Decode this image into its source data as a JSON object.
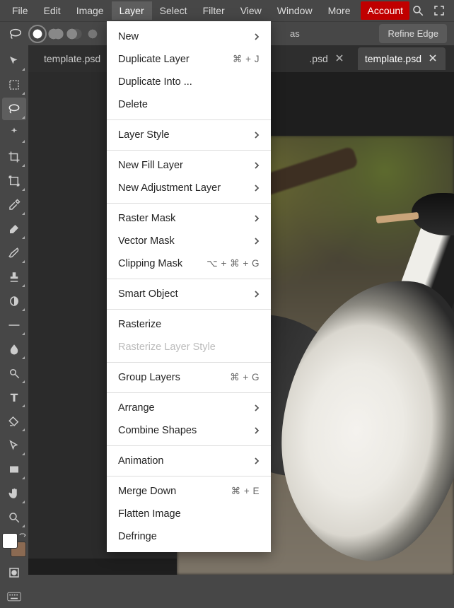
{
  "menubar": {
    "items": [
      "File",
      "Edit",
      "Image",
      "Layer",
      "Select",
      "Filter",
      "View",
      "Window",
      "More"
    ],
    "active_index": 3,
    "account": "Account"
  },
  "toolbar": {
    "as_label_fragment": "as",
    "refine_edge": "Refine Edge"
  },
  "tabs": [
    {
      "label": "template.psd",
      "closable": false
    },
    {
      "label": ".psd",
      "closable": true
    },
    {
      "label": "template.psd",
      "closable": true,
      "active": true
    }
  ],
  "dropdown": {
    "sections": [
      [
        {
          "label": "New",
          "submenu": true
        },
        {
          "label": "Duplicate Layer",
          "shortcut": "⌘ + J"
        },
        {
          "label": "Duplicate Into ..."
        },
        {
          "label": "Delete"
        }
      ],
      [
        {
          "label": "Layer Style",
          "submenu": true
        }
      ],
      [
        {
          "label": "New Fill Layer",
          "submenu": true
        },
        {
          "label": "New Adjustment Layer",
          "submenu": true
        }
      ],
      [
        {
          "label": "Raster Mask",
          "submenu": true
        },
        {
          "label": "Vector Mask",
          "submenu": true
        },
        {
          "label": "Clipping Mask",
          "shortcut": "⌥ + ⌘ + G"
        }
      ],
      [
        {
          "label": "Smart Object",
          "submenu": true
        }
      ],
      [
        {
          "label": "Rasterize"
        },
        {
          "label": "Rasterize Layer Style",
          "disabled": true
        }
      ],
      [
        {
          "label": "Group Layers",
          "shortcut": "⌘ + G"
        }
      ],
      [
        {
          "label": "Arrange",
          "submenu": true
        },
        {
          "label": "Combine Shapes",
          "submenu": true
        }
      ],
      [
        {
          "label": "Animation",
          "submenu": true
        }
      ],
      [
        {
          "label": "Merge Down",
          "shortcut": "⌘ + E"
        },
        {
          "label": "Flatten Image"
        },
        {
          "label": "Defringe"
        }
      ]
    ]
  },
  "left_tools": [
    "move",
    "marquee",
    "lasso",
    "magic-wand",
    "crop",
    "transform",
    "eyedropper",
    "eraser",
    "brush",
    "stamp",
    "gradient",
    "dash",
    "blur",
    "sharpen",
    "type",
    "pen",
    "path-select",
    "rectangle",
    "hand",
    "zoom"
  ],
  "left_tools_active_index": 2,
  "colors": {
    "fg": "#ffffff",
    "bg": "#8b6a52"
  }
}
